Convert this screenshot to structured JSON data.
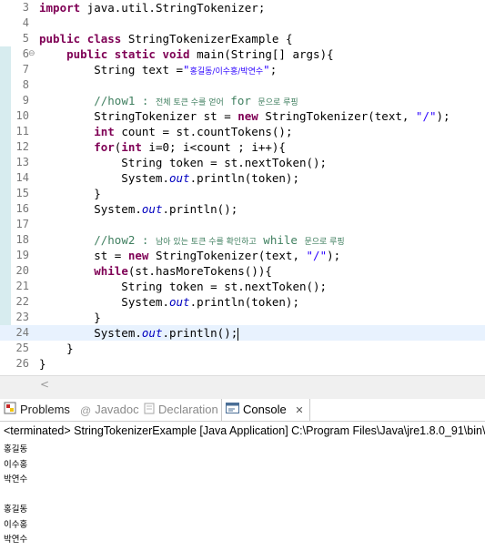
{
  "editor": {
    "lines": [
      {
        "num": "3",
        "tokens": [
          {
            "t": "import",
            "c": "kw"
          },
          {
            "t": " java.util.StringTokenizer;"
          }
        ]
      },
      {
        "num": "4",
        "tokens": []
      },
      {
        "num": "5",
        "tokens": [
          {
            "t": "public",
            "c": "kw"
          },
          {
            "t": " "
          },
          {
            "t": "class",
            "c": "kw"
          },
          {
            "t": " StringTokenizerExample {"
          }
        ]
      },
      {
        "num": "6",
        "fold": "⊖",
        "tokens": [
          {
            "t": "    "
          },
          {
            "t": "public",
            "c": "kw"
          },
          {
            "t": " "
          },
          {
            "t": "static",
            "c": "kw"
          },
          {
            "t": " "
          },
          {
            "t": "void",
            "c": "kw"
          },
          {
            "t": " main(String[] args){"
          }
        ]
      },
      {
        "num": "7",
        "tokens": [
          {
            "t": "        String text ="
          },
          {
            "t": "\"",
            "c": "str"
          },
          {
            "t": "홍길동/이수홍/박연수",
            "c": "str cmk"
          },
          {
            "t": "\"",
            "c": "str"
          },
          {
            "t": ";"
          }
        ]
      },
      {
        "num": "8",
        "tokens": []
      },
      {
        "num": "9",
        "tokens": [
          {
            "t": "        "
          },
          {
            "t": "//how1 : ",
            "c": "cm"
          },
          {
            "t": "전체 토큰 수를 얻어",
            "c": "cm cmk"
          },
          {
            "t": " for ",
            "c": "cm"
          },
          {
            "t": "문으로 루핑",
            "c": "cm cmk"
          }
        ]
      },
      {
        "num": "10",
        "tokens": [
          {
            "t": "        StringTokenizer st = "
          },
          {
            "t": "new",
            "c": "kw"
          },
          {
            "t": " StringTokenizer(text, "
          },
          {
            "t": "\"/\"",
            "c": "str"
          },
          {
            "t": ");"
          }
        ]
      },
      {
        "num": "11",
        "tokens": [
          {
            "t": "        "
          },
          {
            "t": "int",
            "c": "kw"
          },
          {
            "t": " count = st.countTokens();"
          }
        ]
      },
      {
        "num": "12",
        "tokens": [
          {
            "t": "        "
          },
          {
            "t": "for",
            "c": "kw"
          },
          {
            "t": "("
          },
          {
            "t": "int",
            "c": "kw"
          },
          {
            "t": " i=0; i<count ; i++){"
          }
        ]
      },
      {
        "num": "13",
        "tokens": [
          {
            "t": "            String token = st.nextToken();"
          }
        ]
      },
      {
        "num": "14",
        "tokens": [
          {
            "t": "            System."
          },
          {
            "t": "out",
            "c": "fld"
          },
          {
            "t": ".println(token);"
          }
        ]
      },
      {
        "num": "15",
        "tokens": [
          {
            "t": "        }"
          }
        ]
      },
      {
        "num": "16",
        "tokens": [
          {
            "t": "        System."
          },
          {
            "t": "out",
            "c": "fld"
          },
          {
            "t": ".println();"
          }
        ]
      },
      {
        "num": "17",
        "tokens": []
      },
      {
        "num": "18",
        "tokens": [
          {
            "t": "        "
          },
          {
            "t": "//how2 : ",
            "c": "cm"
          },
          {
            "t": "남아 있는 토큰 수를 확인하고",
            "c": "cm cmk"
          },
          {
            "t": " while ",
            "c": "cm"
          },
          {
            "t": "문으로 루핑",
            "c": "cm cmk"
          }
        ]
      },
      {
        "num": "19",
        "tokens": [
          {
            "t": "        st = "
          },
          {
            "t": "new",
            "c": "kw"
          },
          {
            "t": " StringTokenizer(text, "
          },
          {
            "t": "\"/\"",
            "c": "str"
          },
          {
            "t": ");"
          }
        ]
      },
      {
        "num": "20",
        "tokens": [
          {
            "t": "        "
          },
          {
            "t": "while",
            "c": "kw"
          },
          {
            "t": "(st.hasMoreTokens()){"
          }
        ]
      },
      {
        "num": "21",
        "tokens": [
          {
            "t": "            String token = st.nextToken();"
          }
        ]
      },
      {
        "num": "22",
        "tokens": [
          {
            "t": "            System."
          },
          {
            "t": "out",
            "c": "fld"
          },
          {
            "t": ".println(token);"
          }
        ]
      },
      {
        "num": "23",
        "tokens": [
          {
            "t": "        }"
          }
        ]
      },
      {
        "num": "24",
        "current": true,
        "tokens": [
          {
            "t": "        System."
          },
          {
            "t": "out",
            "c": "fld"
          },
          {
            "t": ".println();"
          },
          {
            "t": "",
            "c": "caret"
          }
        ]
      },
      {
        "num": "25",
        "tokens": [
          {
            "t": "    }"
          }
        ]
      },
      {
        "num": "26",
        "tokens": [
          {
            "t": "}"
          }
        ]
      }
    ]
  },
  "tabs": {
    "problems": "Problems",
    "javadoc": "Javadoc",
    "declaration": "Declaration",
    "console": "Console",
    "console_close": "✕"
  },
  "console": {
    "terminated": "<terminated> StringTokenizerExample [Java Application] C:\\Program Files\\Java\\jre1.8.0_91\\bin\\",
    "output": [
      "홍길동",
      "이수홍",
      "박연수",
      "",
      "홍길동",
      "이수홍",
      "박연수"
    ]
  },
  "colors": {
    "keyword": "#7f0055",
    "string": "#2a00ff",
    "comment": "#3f7f5f",
    "field": "#0000c0",
    "current_line": "#e8f2fe",
    "change_bar": "#d7ecef"
  },
  "icons": {
    "problems": "problems-icon",
    "javadoc": "javadoc-icon",
    "declaration": "declaration-icon",
    "console": "console-icon"
  }
}
